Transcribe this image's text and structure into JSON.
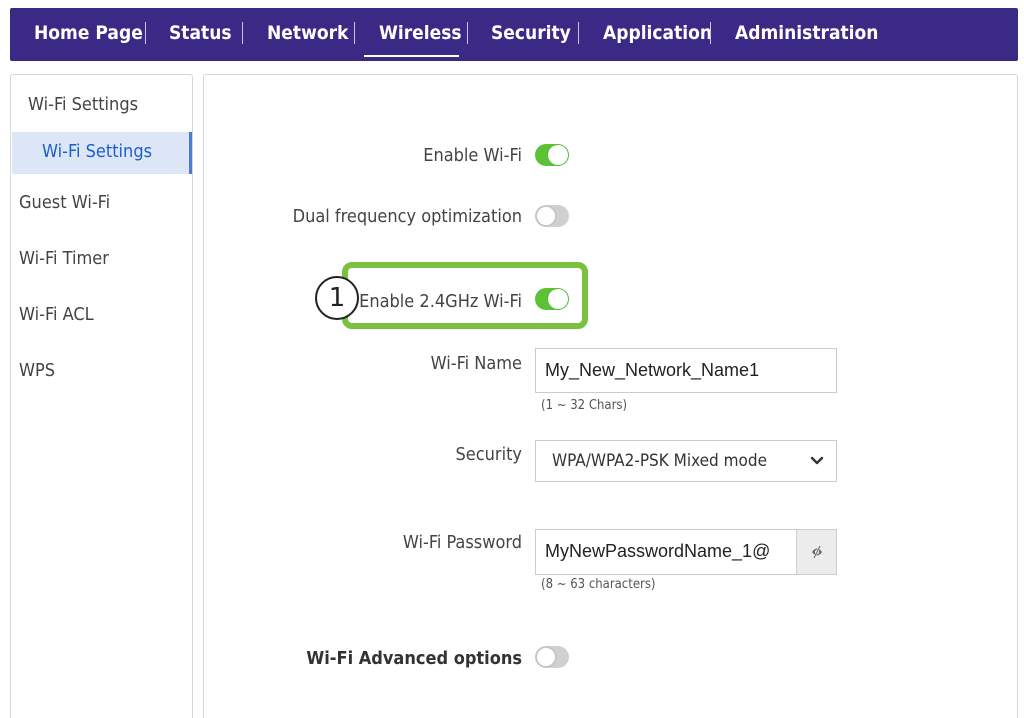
{
  "nav": {
    "items": [
      "Home Page",
      "Status",
      "Network",
      "Wireless",
      "Security",
      "Application",
      "Administration"
    ],
    "active": "Wireless"
  },
  "sidebar": {
    "section": "Wi-Fi Settings",
    "active_sub": "Wi-Fi Settings",
    "items": [
      "Guest Wi-Fi",
      "Wi-Fi Timer",
      "Wi-Fi ACL",
      "WPS"
    ]
  },
  "form": {
    "enable_wifi": {
      "label": "Enable Wi-Fi",
      "on": true
    },
    "dual_freq": {
      "label": "Dual frequency optimization",
      "on": false
    },
    "enable_24": {
      "label": "Enable 2.4GHz Wi-Fi",
      "on": true
    },
    "wifi_name": {
      "label": "Wi-Fi Name",
      "value": "My_New_Network_Name1",
      "hint": "(1 ~ 32 Chars)"
    },
    "security": {
      "label": "Security",
      "selected": "WPA/WPA2-PSK Mixed mode"
    },
    "wifi_password": {
      "label": "Wi-Fi Password",
      "value": "MyNewPasswordName_1@",
      "hint": "(8 ~ 63 characters)"
    },
    "advanced": {
      "label": "Wi-Fi Advanced options",
      "on": false
    }
  },
  "annotation": {
    "step": "1",
    "color": "#7ac142"
  },
  "colors": {
    "nav_bg": "#3a2a85",
    "toggle_on": "#5bc236",
    "toggle_off": "#d0d0d0",
    "active_bg": "#dce6f7",
    "active_text": "#1a5fd0"
  },
  "icons": {
    "password_toggle": "eye-slash-icon",
    "dropdown": "chevron-down-icon"
  }
}
